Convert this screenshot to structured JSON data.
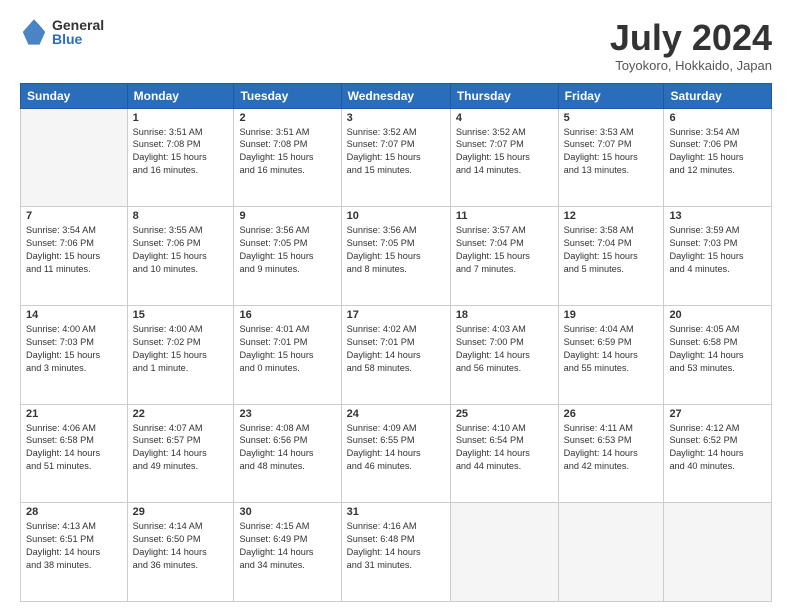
{
  "logo": {
    "general": "General",
    "blue": "Blue"
  },
  "title": "July 2024",
  "location": "Toyokoro, Hokkaido, Japan",
  "days_header": [
    "Sunday",
    "Monday",
    "Tuesday",
    "Wednesday",
    "Thursday",
    "Friday",
    "Saturday"
  ],
  "weeks": [
    [
      {
        "day": "",
        "info": ""
      },
      {
        "day": "1",
        "info": "Sunrise: 3:51 AM\nSunset: 7:08 PM\nDaylight: 15 hours\nand 16 minutes."
      },
      {
        "day": "2",
        "info": "Sunrise: 3:51 AM\nSunset: 7:08 PM\nDaylight: 15 hours\nand 16 minutes."
      },
      {
        "day": "3",
        "info": "Sunrise: 3:52 AM\nSunset: 7:07 PM\nDaylight: 15 hours\nand 15 minutes."
      },
      {
        "day": "4",
        "info": "Sunrise: 3:52 AM\nSunset: 7:07 PM\nDaylight: 15 hours\nand 14 minutes."
      },
      {
        "day": "5",
        "info": "Sunrise: 3:53 AM\nSunset: 7:07 PM\nDaylight: 15 hours\nand 13 minutes."
      },
      {
        "day": "6",
        "info": "Sunrise: 3:54 AM\nSunset: 7:06 PM\nDaylight: 15 hours\nand 12 minutes."
      }
    ],
    [
      {
        "day": "7",
        "info": "Sunrise: 3:54 AM\nSunset: 7:06 PM\nDaylight: 15 hours\nand 11 minutes."
      },
      {
        "day": "8",
        "info": "Sunrise: 3:55 AM\nSunset: 7:06 PM\nDaylight: 15 hours\nand 10 minutes."
      },
      {
        "day": "9",
        "info": "Sunrise: 3:56 AM\nSunset: 7:05 PM\nDaylight: 15 hours\nand 9 minutes."
      },
      {
        "day": "10",
        "info": "Sunrise: 3:56 AM\nSunset: 7:05 PM\nDaylight: 15 hours\nand 8 minutes."
      },
      {
        "day": "11",
        "info": "Sunrise: 3:57 AM\nSunset: 7:04 PM\nDaylight: 15 hours\nand 7 minutes."
      },
      {
        "day": "12",
        "info": "Sunrise: 3:58 AM\nSunset: 7:04 PM\nDaylight: 15 hours\nand 5 minutes."
      },
      {
        "day": "13",
        "info": "Sunrise: 3:59 AM\nSunset: 7:03 PM\nDaylight: 15 hours\nand 4 minutes."
      }
    ],
    [
      {
        "day": "14",
        "info": "Sunrise: 4:00 AM\nSunset: 7:03 PM\nDaylight: 15 hours\nand 3 minutes."
      },
      {
        "day": "15",
        "info": "Sunrise: 4:00 AM\nSunset: 7:02 PM\nDaylight: 15 hours\nand 1 minute."
      },
      {
        "day": "16",
        "info": "Sunrise: 4:01 AM\nSunset: 7:01 PM\nDaylight: 15 hours\nand 0 minutes."
      },
      {
        "day": "17",
        "info": "Sunrise: 4:02 AM\nSunset: 7:01 PM\nDaylight: 14 hours\nand 58 minutes."
      },
      {
        "day": "18",
        "info": "Sunrise: 4:03 AM\nSunset: 7:00 PM\nDaylight: 14 hours\nand 56 minutes."
      },
      {
        "day": "19",
        "info": "Sunrise: 4:04 AM\nSunset: 6:59 PM\nDaylight: 14 hours\nand 55 minutes."
      },
      {
        "day": "20",
        "info": "Sunrise: 4:05 AM\nSunset: 6:58 PM\nDaylight: 14 hours\nand 53 minutes."
      }
    ],
    [
      {
        "day": "21",
        "info": "Sunrise: 4:06 AM\nSunset: 6:58 PM\nDaylight: 14 hours\nand 51 minutes."
      },
      {
        "day": "22",
        "info": "Sunrise: 4:07 AM\nSunset: 6:57 PM\nDaylight: 14 hours\nand 49 minutes."
      },
      {
        "day": "23",
        "info": "Sunrise: 4:08 AM\nSunset: 6:56 PM\nDaylight: 14 hours\nand 48 minutes."
      },
      {
        "day": "24",
        "info": "Sunrise: 4:09 AM\nSunset: 6:55 PM\nDaylight: 14 hours\nand 46 minutes."
      },
      {
        "day": "25",
        "info": "Sunrise: 4:10 AM\nSunset: 6:54 PM\nDaylight: 14 hours\nand 44 minutes."
      },
      {
        "day": "26",
        "info": "Sunrise: 4:11 AM\nSunset: 6:53 PM\nDaylight: 14 hours\nand 42 minutes."
      },
      {
        "day": "27",
        "info": "Sunrise: 4:12 AM\nSunset: 6:52 PM\nDaylight: 14 hours\nand 40 minutes."
      }
    ],
    [
      {
        "day": "28",
        "info": "Sunrise: 4:13 AM\nSunset: 6:51 PM\nDaylight: 14 hours\nand 38 minutes."
      },
      {
        "day": "29",
        "info": "Sunrise: 4:14 AM\nSunset: 6:50 PM\nDaylight: 14 hours\nand 36 minutes."
      },
      {
        "day": "30",
        "info": "Sunrise: 4:15 AM\nSunset: 6:49 PM\nDaylight: 14 hours\nand 34 minutes."
      },
      {
        "day": "31",
        "info": "Sunrise: 4:16 AM\nSunset: 6:48 PM\nDaylight: 14 hours\nand 31 minutes."
      },
      {
        "day": "",
        "info": ""
      },
      {
        "day": "",
        "info": ""
      },
      {
        "day": "",
        "info": ""
      }
    ]
  ]
}
